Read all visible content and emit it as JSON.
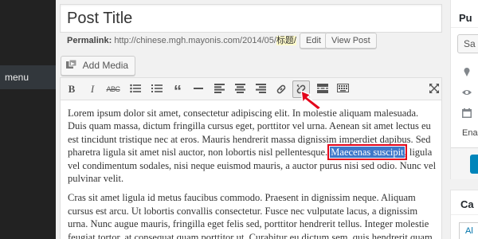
{
  "admin_menu": {
    "menu_label": "menu"
  },
  "post": {
    "title": "Post Title",
    "permalink_label": "Permalink:",
    "permalink_url": "http://chinese.mgh.mayonis.com/2014/05/",
    "permalink_slug": "标题/",
    "edit_label": "Edit",
    "view_label": "View Post"
  },
  "add_media_label": "Add Media",
  "toolbar": {
    "icons": [
      "bold-icon",
      "italic-icon",
      "strikethrough-icon",
      "bullet-list-icon",
      "numbered-list-icon",
      "blockquote-icon",
      "horizontal-rule-icon",
      "align-left-icon",
      "align-center-icon",
      "align-right-icon",
      "link-icon",
      "unlink-icon",
      "read-more-icon",
      "toolbar-toggle-icon",
      "fullscreen-icon"
    ],
    "bold": "B",
    "italic": "I",
    "strikethrough": "ABC",
    "blockquote": "“"
  },
  "content": {
    "p1_before": "Lorem ipsum dolor sit amet, consectetur adipiscing elit. In molestie aliquam malesuada. Duis quam massa, dictum fringilla cursus eget, porttitor vel urna. Aenean sit amet lectus eu est tincidunt tristique nec at eros. Mauris hendrerit massa dignissim imperdiet dapibus. Sed pharetra ligula sit amet nisl auctor, non lobortis nisl pellentesque. ",
    "p1_selected": "Maecenas suscipit",
    "p1_after": ", ligula vel condimentum sodales, nisi neque euismod mauris, a auctor purus nisi sed odio. Nunc vel pulvinar velit.",
    "p2": "Cras sit amet ligula id metus faucibus commodo. Praesent in dignissim neque. Aliquam cursus est arcu. Ut lobortis convallis consectetur. Fusce nec vulputate lacus, a dignissim urna. Nunc augue mauris, fringilla eget felis sed, porttitor hendrerit tellus. Integer molestie feugiat tortor, at consequat quam porttitor ut. Curabitur eu dictum sem, quis hendrerit quam."
  },
  "publish_box": {
    "title": "Pu",
    "save_label": "Sa",
    "enable_label": "Ena"
  },
  "categories_box": {
    "title": "Ca",
    "all_tab": "Al"
  },
  "colors": {
    "selection": "#3f78c9",
    "highlight_border": "#e3051b",
    "arrow": "#e3051b",
    "admin_bar": "#222222"
  }
}
